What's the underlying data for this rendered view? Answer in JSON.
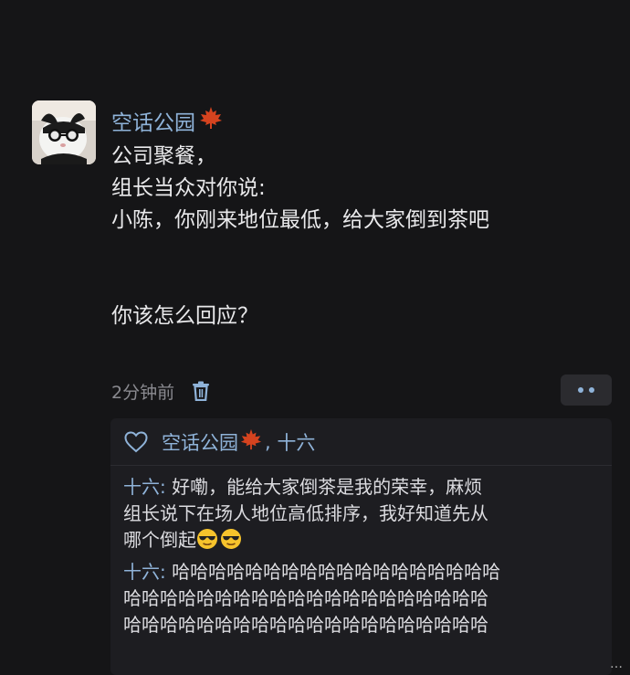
{
  "post": {
    "author": "空话公园",
    "author_badge": "maple-leaf-icon",
    "lines": [
      "公司聚餐，",
      "组长当众对你说:",
      "小陈，你刚来地位最低，给大家倒到茶吧",
      "你该怎么回应？"
    ],
    "time": "2分钟前"
  },
  "likes": {
    "name1": "空话公园",
    "separator": ", ",
    "name2": "十六"
  },
  "comments": [
    {
      "author": "十六:",
      "lines": [
        " 好嘞，能给大家倒茶是我的荣幸，麻烦",
        "组长说下在场人地位高低排序，我好知道先从",
        "哪个倒起"
      ],
      "emojis": [
        "sunglasses-emoji",
        "sunglasses-emoji"
      ]
    },
    {
      "author": "十六:",
      "lines": [
        " 哈哈哈哈哈哈哈哈哈哈哈哈哈哈哈哈哈哈",
        "哈哈哈哈哈哈哈哈哈哈哈哈哈哈哈哈哈哈哈哈",
        "哈哈哈哈哈哈哈哈哈哈哈哈哈哈哈哈哈哈哈哈"
      ]
    }
  ],
  "watermark": "…",
  "colors": {
    "background": "#151517",
    "link": "#8fb3d9",
    "text": "#e9e9eb",
    "muted": "#8a8a90",
    "comment_bg": "#1d1d21"
  }
}
